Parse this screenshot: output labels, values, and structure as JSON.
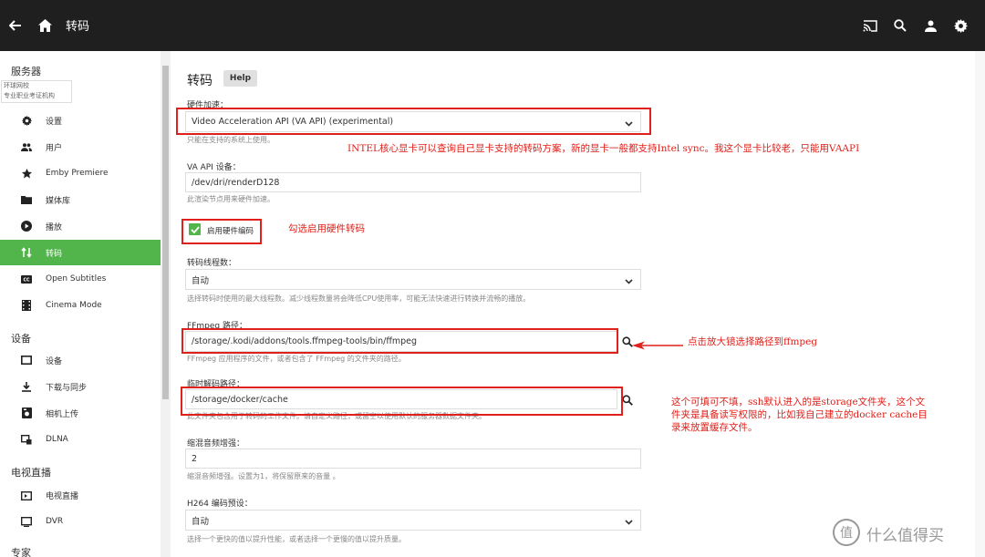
{
  "topbar": {
    "title": "转码"
  },
  "sidebar": {
    "server_section": "服务器",
    "watermark_line1": "环球网校",
    "watermark_line2": "专业职业考证机构",
    "server_items": [
      {
        "label": "设置",
        "icon": "gear-icon"
      },
      {
        "label": "用户",
        "icon": "people-icon"
      },
      {
        "label": "Emby Premiere",
        "icon": "star-icon"
      },
      {
        "label": "媒体库",
        "icon": "folder-icon"
      },
      {
        "label": "播放",
        "icon": "play-circle-icon"
      },
      {
        "label": "转码",
        "icon": "transcode-icon",
        "active": true
      },
      {
        "label": "Open Subtitles",
        "icon": "cc-icon"
      },
      {
        "label": "Cinema Mode",
        "icon": "film-icon"
      }
    ],
    "device_section": "设备",
    "device_items": [
      {
        "label": "设备",
        "icon": "device-icon"
      },
      {
        "label": "下载与同步",
        "icon": "download-icon"
      },
      {
        "label": "相机上传",
        "icon": "camera-icon"
      },
      {
        "label": "DLNA",
        "icon": "dlna-icon"
      }
    ],
    "tv_section": "电视直播",
    "tv_items": [
      {
        "label": "电视直播",
        "icon": "tv-icon"
      },
      {
        "label": "DVR",
        "icon": "dvr-icon"
      }
    ],
    "expert_section": "专家"
  },
  "main": {
    "title": "转码",
    "help_label": "Help",
    "hw_accel_label": "硬件加速：",
    "hw_accel_value": "Video Acceleration API (VA API) (experimental)",
    "hw_accel_desc": "只能在支持的系统上使用。",
    "vaapi_label": "VA API 设备：",
    "vaapi_value": "/dev/dri/renderD128",
    "vaapi_desc": "此渲染节点用来硬件加速。",
    "hw_encode_label": "启用硬件编码",
    "threads_label": "转码线程数：",
    "threads_value": "自动",
    "threads_desc": "选择转码时使用的最大线程数。减少线程数量将会降低CPU使用率，可能无法快速进行转换并流畅的播放。",
    "ffmpeg_label": "FFmpeg 路径：",
    "ffmpeg_value": "/storage/.kodi/addons/tools.ffmpeg-tools/bin/ffmpeg",
    "ffmpeg_desc": "FFmpeg 应用程序的文件，或者包含了 FFmpeg 的文件夹的路径。",
    "temp_label": "临时解码路径：",
    "temp_value": "/storage/docker/cache",
    "temp_desc": "此文件夹包含用于转码的工作文件。请自定义路径，或留空以使用默认的服务器数据文件夹。",
    "downmix_label": "缩混音频增强：",
    "downmix_value": "2",
    "downmix_desc": "缩混音频增强。设置为1，将保留原来的音量 。",
    "h264_label": "H264 编码预设：",
    "h264_value": "自动",
    "h264_desc": "选择一个更快的值以提升性能，或者选择一个更慢的值以提升质量。"
  },
  "annotations": {
    "intel_note": "INTEL核心显卡可以查询自己显卡支持的转码方案，新的显卡一般都支持Intel sync。我这个显卡比较老，只能用VAAPI",
    "hw_note": "勾选启用硬件转码",
    "ffmpeg_note": "点击放大镜选择路径到ffmpeg",
    "cache_note_line1": "这个可填可不填，ssh默认进入的是storage文件夹，这个文",
    "cache_note_line2": "件夹是具备读写权限的，比如我自己建立的docker cache目",
    "cache_note_line3": "录来放置缓存文件。"
  },
  "logo": {
    "text": "值 什么值得买"
  },
  "colors": {
    "topbar": "#1f1f1f",
    "accent_green": "#52b54b",
    "annotation_red": "#e0201a"
  }
}
